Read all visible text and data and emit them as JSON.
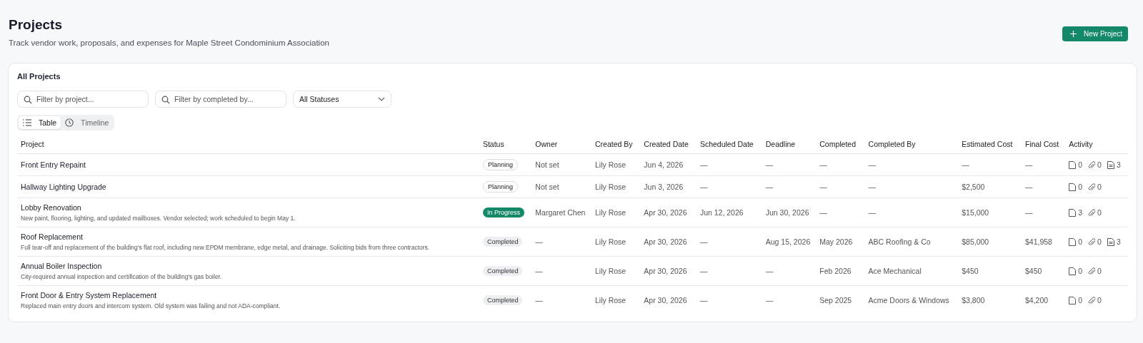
{
  "page": {
    "title": "Projects",
    "subtitle": "Track vendor work, proposals, and expenses for Maple Street Condominium Association",
    "new_button": "New Project"
  },
  "card": {
    "title": "All Projects"
  },
  "filters": {
    "project_search": {
      "placeholder": "Filter by project..."
    },
    "completed_by_search": {
      "placeholder": "Filter by completed by..."
    },
    "status_select": {
      "value": "All Statuses"
    }
  },
  "view_tabs": [
    {
      "label": "Table",
      "kind": "list",
      "selected": true
    },
    {
      "label": "Timeline",
      "kind": "clock",
      "selected": false
    }
  ],
  "table": {
    "columns": [
      "Project",
      "Status",
      "Owner",
      "Created By",
      "Created Date",
      "Scheduled Date",
      "Deadline",
      "Completed",
      "Completed By",
      "Estimated Cost",
      "Final Cost",
      "Activity"
    ],
    "rows": [
      {
        "project": "Front Entry Repaint",
        "status": {
          "label": "Planning",
          "kind": "planning"
        },
        "owner": "Not set",
        "created_by": "Lily Rose",
        "created_date": "Jun 4, 2026",
        "scheduled_date": "—",
        "deadline": "—",
        "completed": "—",
        "completed_by": "—",
        "estimated_cost": "—",
        "final_cost": "—",
        "activity": [
          {
            "kind": "file",
            "count": "0"
          },
          {
            "kind": "clip",
            "count": "0"
          },
          {
            "kind": "note",
            "count": "3"
          }
        ]
      },
      {
        "project": "Hallway Lighting Upgrade",
        "status": {
          "label": "Planning",
          "kind": "planning"
        },
        "owner": "Not set",
        "created_by": "Lily Rose",
        "created_date": "Jun 3, 2026",
        "scheduled_date": "—",
        "deadline": "—",
        "completed": "—",
        "completed_by": "—",
        "estimated_cost": "$2,500",
        "final_cost": "—",
        "activity": [
          {
            "kind": "file",
            "count": "0"
          },
          {
            "kind": "clip",
            "count": "0"
          }
        ]
      },
      {
        "project": "Lobby Renovation",
        "description": "New paint, flooring, lighting, and updated mailboxes. Vendor selected; work scheduled to begin May 1.",
        "status": {
          "label": "In Progress",
          "kind": "progress"
        },
        "owner": "Margaret Chen",
        "created_by": "Lily Rose",
        "created_date": "Apr 30, 2026",
        "scheduled_date": "Jun 12, 2026",
        "deadline": "Jun 30, 2026",
        "completed": "—",
        "completed_by": "—",
        "estimated_cost": "$15,000",
        "final_cost": "—",
        "activity": [
          {
            "kind": "file",
            "count": "3"
          },
          {
            "kind": "clip",
            "count": "0"
          }
        ]
      },
      {
        "project": "Roof Replacement",
        "description": "Full tear-off and replacement of the building's flat roof, including new EPDM membrane, edge metal, and drainage. Soliciting bids from three contractors.",
        "status": {
          "label": "Completed",
          "kind": "completed"
        },
        "owner": "—",
        "created_by": "Lily Rose",
        "created_date": "Apr 30, 2026",
        "scheduled_date": "—",
        "deadline": "Aug 15, 2026",
        "completed": "May 2026",
        "completed_by": "ABC Roofing & Co",
        "estimated_cost": "$85,000",
        "final_cost": "$41,958",
        "activity": [
          {
            "kind": "file",
            "count": "0"
          },
          {
            "kind": "clip",
            "count": "0"
          },
          {
            "kind": "note",
            "count": "3"
          }
        ]
      },
      {
        "project": "Annual Boiler Inspection",
        "description": "City-required annual inspection and certification of the building's gas boiler.",
        "status": {
          "label": "Completed",
          "kind": "completed"
        },
        "owner": "—",
        "created_by": "Lily Rose",
        "created_date": "Apr 30, 2026",
        "scheduled_date": "—",
        "deadline": "—",
        "completed": "Feb 2026",
        "completed_by": "Ace Mechanical",
        "estimated_cost": "$450",
        "final_cost": "$450",
        "activity": [
          {
            "kind": "file",
            "count": "0"
          },
          {
            "kind": "clip",
            "count": "0"
          }
        ]
      },
      {
        "project": "Front Door & Entry System Replacement",
        "description": "Replaced main entry doors and intercom system. Old system was failing and not ADA-compliant.",
        "status": {
          "label": "Completed",
          "kind": "completed"
        },
        "owner": "—",
        "created_by": "Lily Rose",
        "created_date": "Apr 30, 2026",
        "scheduled_date": "—",
        "deadline": "—",
        "completed": "Sep 2025",
        "completed_by": "Acme Doors & Windows",
        "estimated_cost": "$3,800",
        "final_cost": "$4,200",
        "activity": [
          {
            "kind": "file",
            "count": "0"
          },
          {
            "kind": "clip",
            "count": "0"
          }
        ]
      }
    ]
  }
}
